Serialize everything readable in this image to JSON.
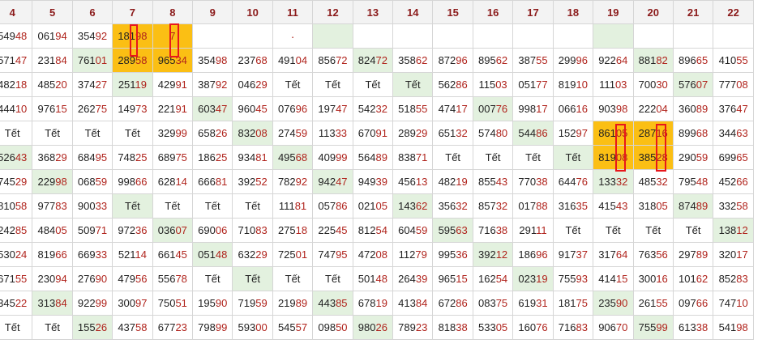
{
  "headers": [
    "4",
    "5",
    "6",
    "7",
    "8",
    "9",
    "10",
    "11",
    "12",
    "13",
    "14",
    "15",
    "16",
    "17",
    "18",
    "19",
    "20",
    "21",
    "22"
  ],
  "rows": [
    [
      {
        "v": "54948"
      },
      {
        "v": "06194"
      },
      {
        "v": "35492"
      },
      {
        "v": "18198",
        "bg": "orange"
      },
      {
        "v": "7",
        "bg": "orange"
      },
      {
        "v": ""
      },
      {
        "v": ""
      },
      {
        "v": "·",
        "dot": true
      },
      {
        "v": "",
        "bg": "green"
      },
      {
        "v": ""
      },
      {
        "v": ""
      },
      {
        "v": ""
      },
      {
        "v": ""
      },
      {
        "v": ""
      },
      {
        "v": ""
      },
      {
        "v": "",
        "bg": "green"
      },
      {
        "v": ""
      },
      {
        "v": ""
      },
      {
        "v": ""
      }
    ],
    [
      {
        "v": "57147"
      },
      {
        "v": "23184"
      },
      {
        "v": "76101",
        "bg": "green"
      },
      {
        "v": "28958",
        "bg": "orange"
      },
      {
        "v": "96534",
        "bg": "orange"
      },
      {
        "v": "35498"
      },
      {
        "v": "23768"
      },
      {
        "v": "49104"
      },
      {
        "v": "85672"
      },
      {
        "v": "82472",
        "bg": "green"
      },
      {
        "v": "35862"
      },
      {
        "v": "87296"
      },
      {
        "v": "89562"
      },
      {
        "v": "38755"
      },
      {
        "v": "29996"
      },
      {
        "v": "92264"
      },
      {
        "v": "88182",
        "bg": "green"
      },
      {
        "v": "89665"
      },
      {
        "v": "41055"
      }
    ],
    [
      {
        "v": "48218"
      },
      {
        "v": "48520"
      },
      {
        "v": "37427"
      },
      {
        "v": "25119",
        "bg": "green"
      },
      {
        "v": "42991"
      },
      {
        "v": "38792"
      },
      {
        "v": "04629"
      },
      {
        "v": "Tết"
      },
      {
        "v": "Tết"
      },
      {
        "v": "Tết"
      },
      {
        "v": "Tết",
        "bg": "green"
      },
      {
        "v": "56286"
      },
      {
        "v": "11503"
      },
      {
        "v": "05177"
      },
      {
        "v": "81910"
      },
      {
        "v": "11103"
      },
      {
        "v": "70030"
      },
      {
        "v": "57607",
        "bg": "green"
      },
      {
        "v": "77708"
      }
    ],
    [
      {
        "v": "44410"
      },
      {
        "v": "97615"
      },
      {
        "v": "26275"
      },
      {
        "v": "14973"
      },
      {
        "v": "22191"
      },
      {
        "v": "60347",
        "bg": "green"
      },
      {
        "v": "96045"
      },
      {
        "v": "07696"
      },
      {
        "v": "19747"
      },
      {
        "v": "54232"
      },
      {
        "v": "51855"
      },
      {
        "v": "47417"
      },
      {
        "v": "00776",
        "bg": "green"
      },
      {
        "v": "99817"
      },
      {
        "v": "06616"
      },
      {
        "v": "90398"
      },
      {
        "v": "22204"
      },
      {
        "v": "36089"
      },
      {
        "v": "37647"
      }
    ],
    [
      {
        "v": "Tết"
      },
      {
        "v": "Tết"
      },
      {
        "v": "Tết"
      },
      {
        "v": "Tết"
      },
      {
        "v": "32999"
      },
      {
        "v": "65826"
      },
      {
        "v": "83208",
        "bg": "green"
      },
      {
        "v": "27459"
      },
      {
        "v": "11333"
      },
      {
        "v": "67091"
      },
      {
        "v": "28929"
      },
      {
        "v": "65132"
      },
      {
        "v": "57480"
      },
      {
        "v": "54486",
        "bg": "green"
      },
      {
        "v": "15297"
      },
      {
        "v": "86105",
        "bg": "orange"
      },
      {
        "v": "28716",
        "bg": "orange"
      },
      {
        "v": "89968"
      },
      {
        "v": "34463"
      }
    ],
    [
      {
        "v": "52643",
        "bg": "green"
      },
      {
        "v": "36829"
      },
      {
        "v": "68495"
      },
      {
        "v": "74825"
      },
      {
        "v": "68975"
      },
      {
        "v": "18625"
      },
      {
        "v": "93481"
      },
      {
        "v": "49568",
        "bg": "green"
      },
      {
        "v": "40999"
      },
      {
        "v": "56489"
      },
      {
        "v": "83871"
      },
      {
        "v": "Tết"
      },
      {
        "v": "Tết"
      },
      {
        "v": "Tết"
      },
      {
        "v": "Tết",
        "bg": "green"
      },
      {
        "v": "81908",
        "bg": "orange"
      },
      {
        "v": "38528",
        "bg": "orange"
      },
      {
        "v": "29059"
      },
      {
        "v": "69965"
      }
    ],
    [
      {
        "v": "74529"
      },
      {
        "v": "22998",
        "bg": "green"
      },
      {
        "v": "06859"
      },
      {
        "v": "99866"
      },
      {
        "v": "62814"
      },
      {
        "v": "66681"
      },
      {
        "v": "39252"
      },
      {
        "v": "78292"
      },
      {
        "v": "94247",
        "bg": "green"
      },
      {
        "v": "94939"
      },
      {
        "v": "45613"
      },
      {
        "v": "48219"
      },
      {
        "v": "85543"
      },
      {
        "v": "77038"
      },
      {
        "v": "64476"
      },
      {
        "v": "13332",
        "bg": "green"
      },
      {
        "v": "48532"
      },
      {
        "v": "79548"
      },
      {
        "v": "45266"
      }
    ],
    [
      {
        "v": "81058"
      },
      {
        "v": "97783"
      },
      {
        "v": "90033"
      },
      {
        "v": "Tết",
        "bg": "green"
      },
      {
        "v": "Tết"
      },
      {
        "v": "Tết"
      },
      {
        "v": "Tết"
      },
      {
        "v": "11181"
      },
      {
        "v": "05786"
      },
      {
        "v": "02105"
      },
      {
        "v": "14362",
        "bg": "green"
      },
      {
        "v": "35632"
      },
      {
        "v": "85732"
      },
      {
        "v": "01788"
      },
      {
        "v": "31635"
      },
      {
        "v": "41543"
      },
      {
        "v": "31805"
      },
      {
        "v": "87489",
        "bg": "green"
      },
      {
        "v": "33258"
      }
    ],
    [
      {
        "v": "24285"
      },
      {
        "v": "48405"
      },
      {
        "v": "50971"
      },
      {
        "v": "97236"
      },
      {
        "v": "03607",
        "bg": "green"
      },
      {
        "v": "69006"
      },
      {
        "v": "71083"
      },
      {
        "v": "27518"
      },
      {
        "v": "22545"
      },
      {
        "v": "81254"
      },
      {
        "v": "60459"
      },
      {
        "v": "59563",
        "bg": "green"
      },
      {
        "v": "71638"
      },
      {
        "v": "29111"
      },
      {
        "v": "Tết"
      },
      {
        "v": "Tết"
      },
      {
        "v": "Tết"
      },
      {
        "v": "Tết"
      },
      {
        "v": "13812",
        "bg": "green"
      }
    ],
    [
      {
        "v": "53024"
      },
      {
        "v": "81966"
      },
      {
        "v": "66933"
      },
      {
        "v": "52114"
      },
      {
        "v": "66145"
      },
      {
        "v": "05148",
        "bg": "green"
      },
      {
        "v": "63229"
      },
      {
        "v": "72501"
      },
      {
        "v": "74795"
      },
      {
        "v": "47208"
      },
      {
        "v": "11279"
      },
      {
        "v": "99536"
      },
      {
        "v": "39212",
        "bg": "green"
      },
      {
        "v": "18696"
      },
      {
        "v": "91737"
      },
      {
        "v": "31764"
      },
      {
        "v": "76356"
      },
      {
        "v": "29789"
      },
      {
        "v": "32017"
      }
    ],
    [
      {
        "v": "67155"
      },
      {
        "v": "23094"
      },
      {
        "v": "27690"
      },
      {
        "v": "47956"
      },
      {
        "v": "55678"
      },
      {
        "v": "Tết"
      },
      {
        "v": "Tết",
        "bg": "green"
      },
      {
        "v": "Tết"
      },
      {
        "v": "Tết"
      },
      {
        "v": "50148"
      },
      {
        "v": "26439"
      },
      {
        "v": "96515"
      },
      {
        "v": "16254"
      },
      {
        "v": "02319",
        "bg": "green"
      },
      {
        "v": "75593"
      },
      {
        "v": "41415"
      },
      {
        "v": "30016"
      },
      {
        "v": "10162"
      },
      {
        "v": "85283"
      }
    ],
    [
      {
        "v": "34522"
      },
      {
        "v": "31384",
        "bg": "green"
      },
      {
        "v": "92299"
      },
      {
        "v": "30097"
      },
      {
        "v": "75051"
      },
      {
        "v": "19590"
      },
      {
        "v": "71959"
      },
      {
        "v": "21989"
      },
      {
        "v": "44385",
        "bg": "green"
      },
      {
        "v": "67819"
      },
      {
        "v": "41384"
      },
      {
        "v": "67286"
      },
      {
        "v": "08375"
      },
      {
        "v": "61931"
      },
      {
        "v": "18175"
      },
      {
        "v": "23590",
        "bg": "green"
      },
      {
        "v": "26155"
      },
      {
        "v": "09766"
      },
      {
        "v": "74710"
      }
    ],
    [
      {
        "v": "Tết"
      },
      {
        "v": "Tết"
      },
      {
        "v": "15526",
        "bg": "green"
      },
      {
        "v": "43758"
      },
      {
        "v": "67723"
      },
      {
        "v": "79899"
      },
      {
        "v": "59300"
      },
      {
        "v": "54557"
      },
      {
        "v": "09850"
      },
      {
        "v": "98026",
        "bg": "green"
      },
      {
        "v": "78923"
      },
      {
        "v": "81838"
      },
      {
        "v": "53305"
      },
      {
        "v": "16076"
      },
      {
        "v": "71683"
      },
      {
        "v": "90670"
      },
      {
        "v": "75599",
        "bg": "green"
      },
      {
        "v": "61338"
      },
      {
        "v": "54198"
      }
    ]
  ]
}
